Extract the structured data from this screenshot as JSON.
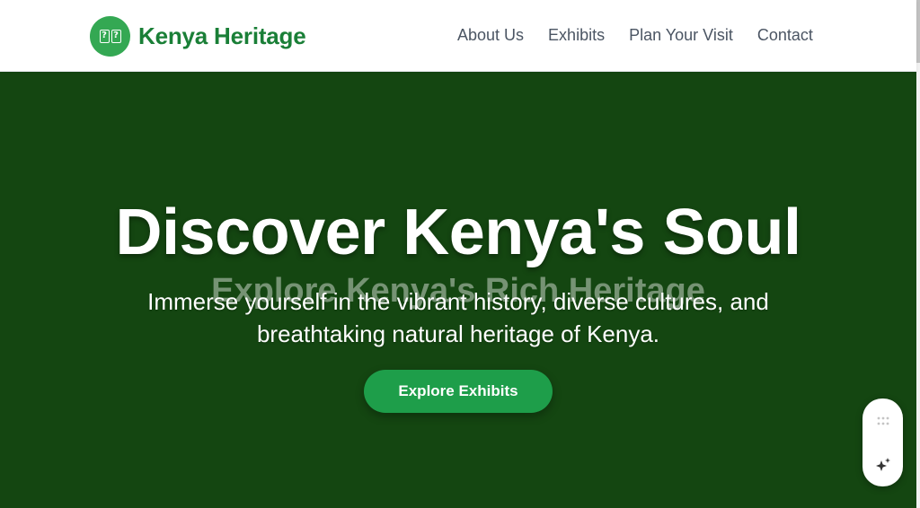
{
  "header": {
    "logo_glyph": "??",
    "logo_text": "Kenya Heritage",
    "nav": [
      {
        "label": "About Us"
      },
      {
        "label": "Exhibits"
      },
      {
        "label": "Plan Your Visit"
      },
      {
        "label": "Contact"
      }
    ]
  },
  "hero": {
    "title": "Discover Kenya's Soul",
    "ghost_subtitle": "Explore Kenya's Rich Heritage",
    "text": "Immerse yourself in the vibrant history, diverse cultures, and breathtaking natural heritage of Kenya.",
    "cta_label": "Explore Exhibits"
  },
  "float_toolbar": {
    "icons": [
      "grip-icon",
      "sparkle-icon"
    ]
  },
  "colors": {
    "brand": "#1a7f37",
    "logo_badge": "#34a853",
    "hero_bg": "#144611",
    "cta_bg": "#1e9e4a",
    "nav_text": "#4b5563"
  }
}
